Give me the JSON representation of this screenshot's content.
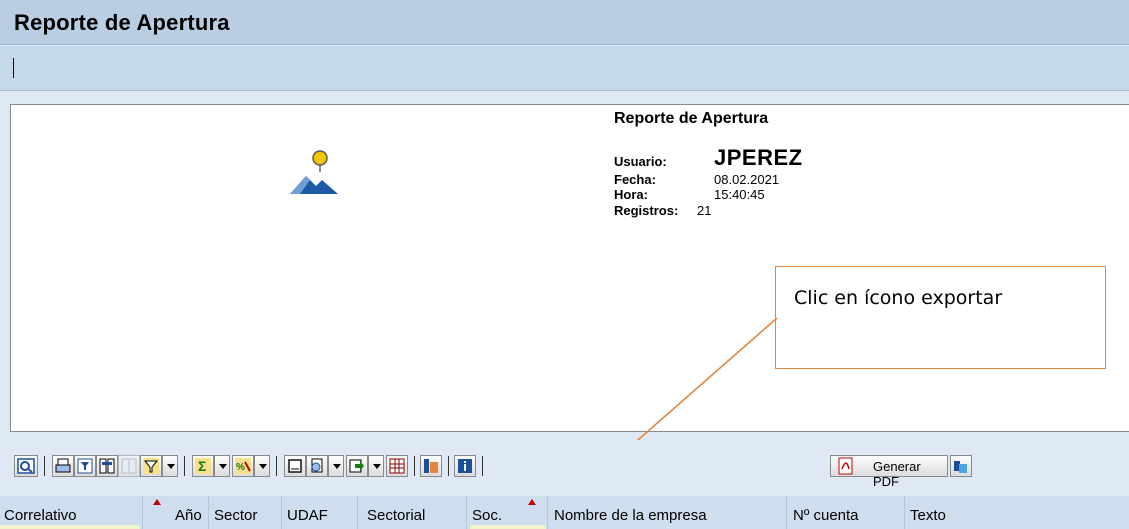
{
  "window": {
    "title": "Reporte de Apertura"
  },
  "report_header": {
    "title": "Reporte de Apertura",
    "usuario_label": "Usuario:",
    "usuario_value": "JPEREZ",
    "fecha_label": "Fecha:",
    "fecha_value": "08.02.2021",
    "hora_label": "Hora:",
    "hora_value": "15:40:45",
    "registros_label": "Registros:",
    "registros_value": "21"
  },
  "callout": {
    "text": "Clic en ícono exportar"
  },
  "toolbar": {
    "icons": [
      "details-icon",
      "print-icon",
      "filter-layout-icon",
      "save-layout-icon",
      "layout-disabled-icon",
      "filter-icon",
      "sum-icon",
      "subtotal-icon",
      "print-preview-icon",
      "view-icon",
      "export-icon",
      "spreadsheet-icon",
      "layout-change-icon",
      "info-icon",
      "pdf-icon",
      "graphic-icon"
    ],
    "generar_pdf_label": "Generar PDF"
  },
  "grid": {
    "columns": [
      "Correlativo",
      "Año",
      "Sector",
      "UDAF",
      "Sectorial",
      "Soc.",
      "Nombre de la empresa",
      "Nº cuenta",
      "Texto"
    ]
  },
  "colors": {
    "title_bar": "#b9cde3",
    "callout_border": "#e4853a",
    "sort_marker": "#c00000"
  }
}
